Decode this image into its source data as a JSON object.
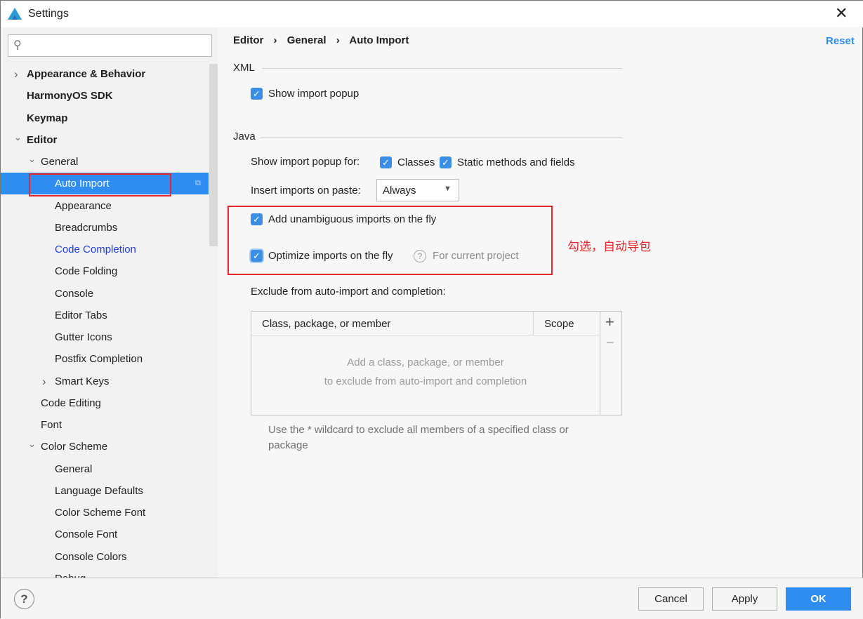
{
  "window": {
    "title": "Settings",
    "close_icon": "close-icon",
    "app_icon": "harmonyos-triangle-logo"
  },
  "search": {
    "placeholder": ""
  },
  "sidebar": {
    "items": [
      {
        "label": "Appearance & Behavior",
        "level": 0,
        "bold": true,
        "chevron": "right"
      },
      {
        "label": "HarmonyOS SDK",
        "level": 0,
        "bold": true
      },
      {
        "label": "Keymap",
        "level": 0,
        "bold": true
      },
      {
        "label": "Editor",
        "level": 0,
        "bold": true,
        "chevron": "down"
      },
      {
        "label": "General",
        "level": 1,
        "chevron": "down"
      },
      {
        "label": "Auto Import",
        "level": 2,
        "selected": true
      },
      {
        "label": "Appearance",
        "level": 2
      },
      {
        "label": "Breadcrumbs",
        "level": 2
      },
      {
        "label": "Code Completion",
        "level": 2,
        "link": true
      },
      {
        "label": "Code Folding",
        "level": 2
      },
      {
        "label": "Console",
        "level": 2
      },
      {
        "label": "Editor Tabs",
        "level": 2
      },
      {
        "label": "Gutter Icons",
        "level": 2
      },
      {
        "label": "Postfix Completion",
        "level": 2
      },
      {
        "label": "Smart Keys",
        "level": 2,
        "chevron": "right"
      },
      {
        "label": "Code Editing",
        "level": 1
      },
      {
        "label": "Font",
        "level": 1
      },
      {
        "label": "Color Scheme",
        "level": 1,
        "chevron": "down"
      },
      {
        "label": "General",
        "level": 2
      },
      {
        "label": "Language Defaults",
        "level": 2
      },
      {
        "label": "Color Scheme Font",
        "level": 2
      },
      {
        "label": "Console Font",
        "level": 2
      },
      {
        "label": "Console Colors",
        "level": 2
      },
      {
        "label": "Debug",
        "level": 2
      }
    ]
  },
  "breadcrumb": [
    "Editor",
    "General",
    "Auto Import"
  ],
  "reset_label": "Reset",
  "xml": {
    "section": "XML",
    "show_import_popup": {
      "label": "Show import popup",
      "checked": true
    }
  },
  "java": {
    "section": "Java",
    "show_popup_for_label": "Show import popup for:",
    "classes": {
      "label": "Classes",
      "checked": true
    },
    "static": {
      "label": "Static methods and fields",
      "checked": true
    },
    "insert_label": "Insert imports on paste:",
    "insert_value": "Always",
    "add_unambiguous": {
      "label": "Add unambiguous imports on the fly",
      "checked": true
    },
    "optimize": {
      "label": "Optimize imports on the fly",
      "checked": true,
      "hint": "For current project"
    },
    "exclude_label": "Exclude from auto-import and completion:",
    "table": {
      "columns": [
        "Class, package, or member",
        "Scope"
      ],
      "empty_line1": "Add a class, package, or member",
      "empty_line2": "to exclude from auto-import and completion",
      "add": "+",
      "remove": "−"
    },
    "wildcard_note": "Use the * wildcard to exclude all members of a specified class or package"
  },
  "annotation": "勾选，自动导包",
  "footer": {
    "help": "?",
    "cancel": "Cancel",
    "apply": "Apply",
    "ok": "OK"
  },
  "colors": {
    "accent": "#2f8cf0",
    "annotation": "#e8262b"
  }
}
